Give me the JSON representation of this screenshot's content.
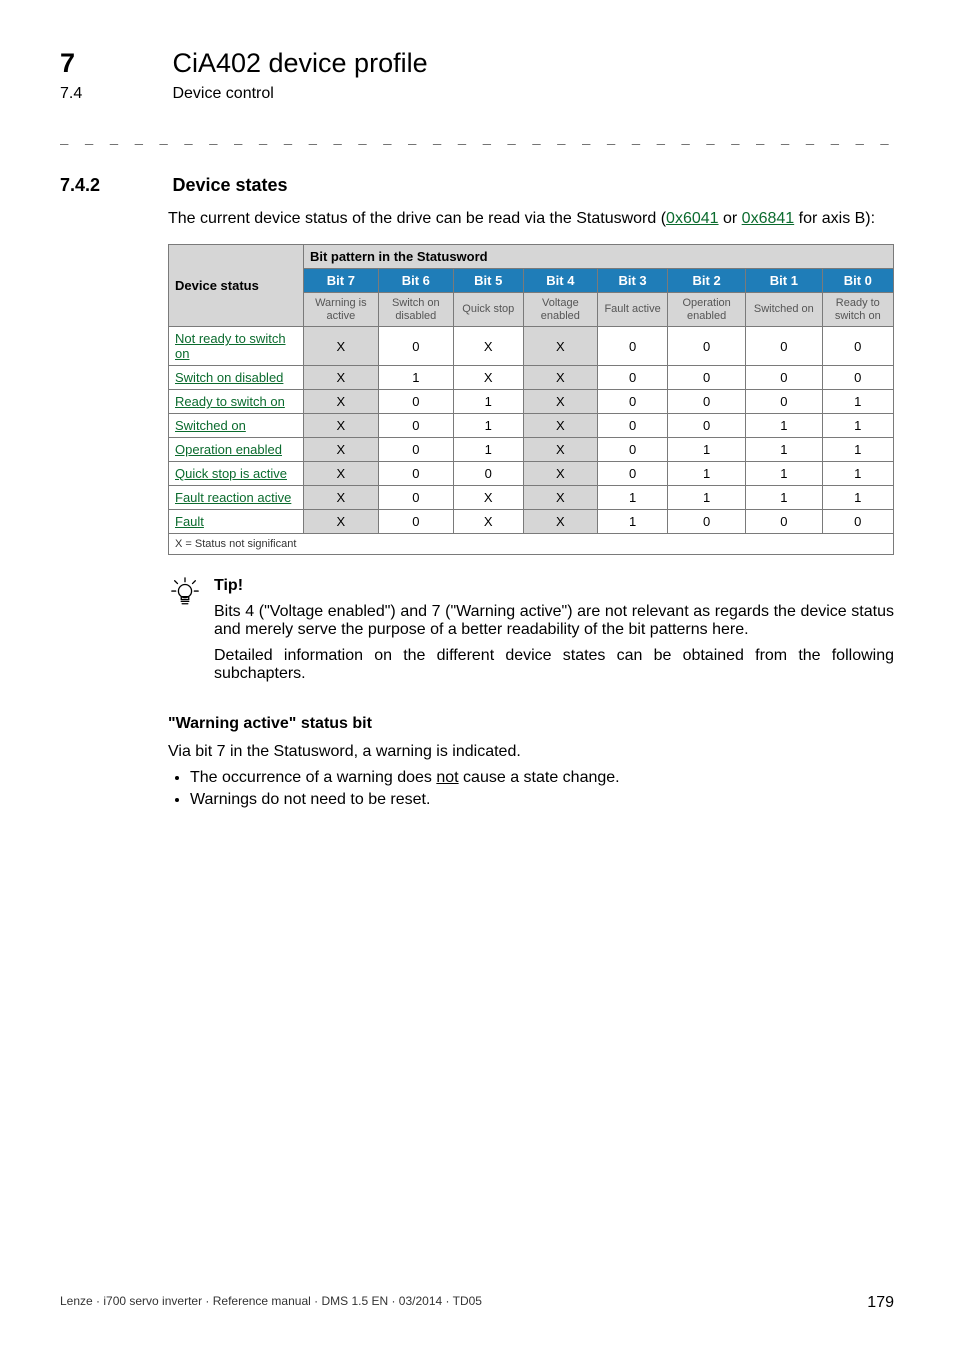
{
  "runhead": {
    "num": "7",
    "title": "CiA402 device profile"
  },
  "runsub": {
    "num": "7.4",
    "title": "Device control"
  },
  "divider": "_ _ _ _ _ _ _ _ _ _ _ _ _ _ _ _ _ _ _ _ _ _ _ _ _ _ _ _ _ _ _ _ _ _ _ _ _ _ _ _ _ _ _ _ _ _ _ _ _ _ _ _ _ _ _ _ _ _ _ _ _ _ _ _",
  "section": {
    "num": "7.4.2",
    "title": "Device states"
  },
  "intro": {
    "pre": "The current device status of the drive can be read via the Statusword (",
    "link1": "0x6041",
    "mid": " or ",
    "link2": "0x6841",
    "post": " for axis B):"
  },
  "table": {
    "cornerHeader": "Device status",
    "groupCaption": "Bit pattern in the Statusword",
    "bitNames": [
      "Bit 7",
      "Bit 6",
      "Bit 5",
      "Bit 4",
      "Bit 3",
      "Bit 2",
      "Bit 1",
      "Bit 0"
    ],
    "bitDescs": [
      "Warning is active",
      "Switch on disabled",
      "Quick stop",
      "Voltage enabled",
      "Fault active",
      "Operation enabled",
      "Switched on",
      "Ready to switch on"
    ],
    "shadeCols": [
      0,
      3
    ],
    "rows": [
      {
        "label": "Not ready to switch on",
        "cells": [
          "X",
          "0",
          "X",
          "X",
          "0",
          "0",
          "0",
          "0"
        ]
      },
      {
        "label": "Switch on disabled",
        "cells": [
          "X",
          "1",
          "X",
          "X",
          "0",
          "0",
          "0",
          "0"
        ]
      },
      {
        "label": "Ready to switch on",
        "cells": [
          "X",
          "0",
          "1",
          "X",
          "0",
          "0",
          "0",
          "1"
        ]
      },
      {
        "label": "Switched on",
        "cells": [
          "X",
          "0",
          "1",
          "X",
          "0",
          "0",
          "1",
          "1"
        ]
      },
      {
        "label": "Operation enabled",
        "cells": [
          "X",
          "0",
          "1",
          "X",
          "0",
          "1",
          "1",
          "1"
        ]
      },
      {
        "label": "Quick stop is active",
        "cells": [
          "X",
          "0",
          "0",
          "X",
          "0",
          "1",
          "1",
          "1"
        ]
      },
      {
        "label": "Fault reaction active",
        "cells": [
          "X",
          "0",
          "X",
          "X",
          "1",
          "1",
          "1",
          "1"
        ]
      },
      {
        "label": "Fault",
        "cells": [
          "X",
          "0",
          "X",
          "X",
          "1",
          "0",
          "0",
          "0"
        ]
      }
    ],
    "footnote": "X = Status not significant"
  },
  "tip": {
    "title": "Tip!",
    "p1": "Bits 4 (\"Voltage enabled\") and 7 (\"Warning active\") are not relevant as regards the device status and merely serve the purpose of a better readability of the bit patterns here.",
    "p2": "Detailed information on the different device states can be obtained from the following subchapters."
  },
  "warningBit": {
    "heading": "\"Warning active\" status bit",
    "para": "Via bit 7 in the Statusword, a warning is indicated.",
    "bullet1_pre": "The occurrence of a warning does ",
    "bullet1_u": "not",
    "bullet1_post": " cause a state change.",
    "bullet2": "Warnings do not need to be reset."
  },
  "footer": {
    "left": "Lenze · i700 servo inverter · Reference manual · DMS 1.5 EN · 03/2014 · TD05",
    "page": "179"
  }
}
